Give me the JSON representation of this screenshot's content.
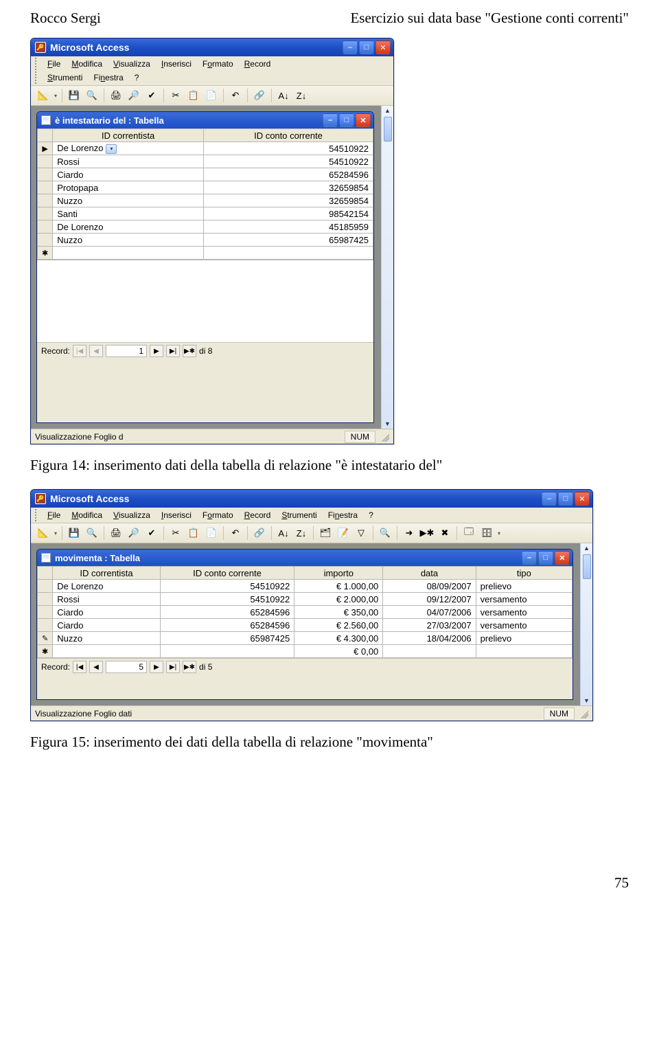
{
  "doc": {
    "header_left": "Rocco Sergi",
    "header_right": "Esercizio sui data base \"Gestione conti correnti\"",
    "caption1": "Figura 14: inserimento dati della tabella di relazione \"è intestatario del\"",
    "caption2": "Figura 15: inserimento dei dati della tabella di relazione \"movimenta\"",
    "page_number": "75"
  },
  "app_title": "Microsoft Access",
  "menus": {
    "file": "File",
    "modifica": "Modifica",
    "visualizza": "Visualizza",
    "inserisci": "Inserisci",
    "formato": "Formato",
    "record": "Record",
    "strumenti": "Strumenti",
    "finestra": "Finestra",
    "help": "?"
  },
  "toolbar_icons": {
    "design": "📐",
    "save": "💾",
    "findrep": "🔍",
    "print": "🖨",
    "preview": "🔎",
    "spell": "✔",
    "cut": "✂",
    "copy": "📋",
    "paste": "📄",
    "undo": "↶",
    "link": "🔗",
    "sortaz": "A↓",
    "sortza": "Z↓",
    "filtersel": "🗂",
    "filterform": "📝",
    "togglefilter": "▽",
    "find": "🔍",
    "goto": "➜",
    "newrec": "▶✱",
    "delrec": "✖",
    "window": "🗔",
    "db": "🗄"
  },
  "window1": {
    "title": "è intestatario del : Tabella",
    "columns": [
      "ID correntista",
      "ID conto corrente"
    ],
    "rows": [
      {
        "sel": "▶",
        "c0": "De Lorenzo",
        "dropdown": true,
        "c1": "54510922"
      },
      {
        "sel": "",
        "c0": "Rossi",
        "c1": "54510922"
      },
      {
        "sel": "",
        "c0": "Ciardo",
        "c1": "65284596"
      },
      {
        "sel": "",
        "c0": "Protopapa",
        "c1": "32659854"
      },
      {
        "sel": "",
        "c0": "Nuzzo",
        "c1": "32659854"
      },
      {
        "sel": "",
        "c0": "Santi",
        "c1": "98542154"
      },
      {
        "sel": "",
        "c0": "De Lorenzo",
        "c1": "45185959"
      },
      {
        "sel": "",
        "c0": "Nuzzo",
        "c1": "65987425"
      },
      {
        "sel": "✱",
        "c0": "",
        "c1": ""
      }
    ],
    "record_label": "Record:",
    "record_value": "1",
    "record_total": "di 8",
    "status_left": "Visualizzazione Foglio d",
    "status_num": "NUM"
  },
  "window2": {
    "title": "movimenta : Tabella",
    "columns": [
      "ID correntista",
      "ID conto corrente",
      "importo",
      "data",
      "tipo"
    ],
    "rows": [
      {
        "sel": "",
        "c0": "De Lorenzo",
        "c1": "54510922",
        "c2": "€ 1.000,00",
        "c3": "08/09/2007",
        "c4": "prelievo"
      },
      {
        "sel": "",
        "c0": "Rossi",
        "c1": "54510922",
        "c2": "€ 2.000,00",
        "c3": "09/12/2007",
        "c4": "versamento"
      },
      {
        "sel": "",
        "c0": "Ciardo",
        "c1": "65284596",
        "c2": "€ 350,00",
        "c3": "04/07/2006",
        "c4": "versamento"
      },
      {
        "sel": "",
        "c0": "Ciardo",
        "c1": "65284596",
        "c2": "€ 2.560,00",
        "c3": "27/03/2007",
        "c4": "versamento"
      },
      {
        "sel": "✎",
        "c0": "Nuzzo",
        "c1": "65987425",
        "c2": "€ 4.300,00",
        "c3": "18/04/2006",
        "c4": "prelievo"
      },
      {
        "sel": "✱",
        "c0": "",
        "c1": "",
        "c2": "€ 0,00",
        "c3": "",
        "c4": ""
      }
    ],
    "record_label": "Record:",
    "record_value": "5",
    "record_total": "di 5",
    "status_left": "Visualizzazione Foglio dati",
    "status_num": "NUM"
  }
}
